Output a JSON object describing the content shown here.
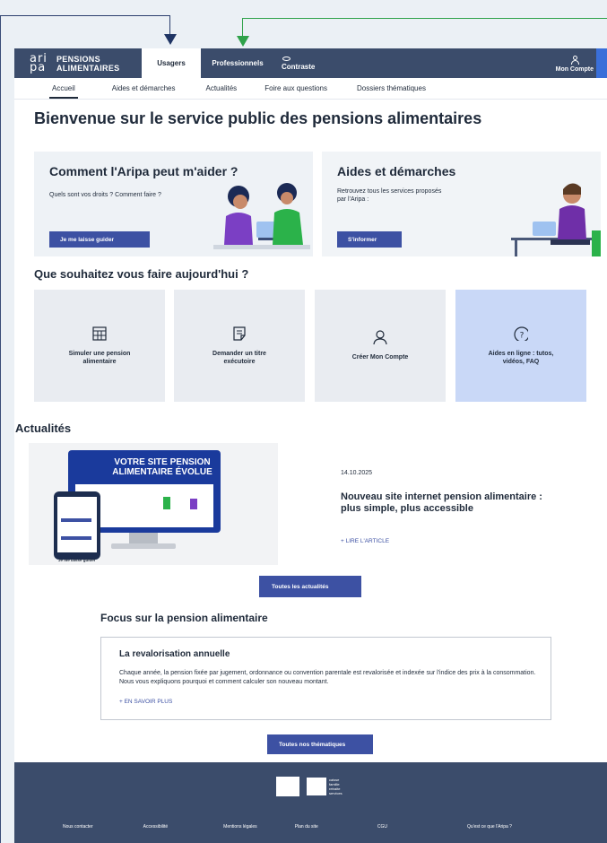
{
  "header": {
    "logo_mark": "ari pa",
    "logo_line1": "PENSIONS",
    "logo_line2": "ALIMENTAIRES",
    "tab_usagers": "Usagers",
    "tab_pros": "Professionnels",
    "contraste": "Contraste",
    "mon_compte": "Mon Compte"
  },
  "subnav": [
    "Accueil",
    "Aides et démarches",
    "Actualités",
    "Foire aux questions",
    "Dossiers thématiques"
  ],
  "welcome": "Bienvenue sur le service public des pensions alimentaires",
  "card1": {
    "title": "Comment l'Aripa peut m'aider ?",
    "text": "Quels sont vos droits ? Comment faire ?",
    "button": "Je me laisse guider"
  },
  "card2": {
    "title": "Aides et démarches",
    "text1": "Retrouvez tous les services proposés",
    "text2": "par l'Aripa :",
    "button": "S'informer"
  },
  "question": "Que souhaitez vous faire aujourd'hui ?",
  "tiles": [
    {
      "label1": "Simuler une pension",
      "label2": "alimentaire",
      "icon": "calculator-icon"
    },
    {
      "label1": "Demander un titre",
      "label2": "exécutoire",
      "icon": "document-icon"
    },
    {
      "label1": "Créer Mon Compte",
      "label2": "",
      "icon": "user-icon"
    },
    {
      "label1": "Aides en ligne : tutos,",
      "label2": "vidéos, FAQ",
      "icon": "help-icon"
    }
  ],
  "actualites": {
    "title": "Actualités",
    "img_line1": "VOTRE SITE PENSION",
    "img_line2": "ALIMENTAIRE ÉVOLUE",
    "img_phone_title": "Je me laisse guider",
    "date": "14.10.2025",
    "headline": "Nouveau site internet pension alimentaire : plus simple, plus accessible",
    "link": "+ LIRE L'ARTICLE",
    "all_button": "Toutes les actualités"
  },
  "focus": {
    "title": "Focus sur la pension alimentaire",
    "box_title": "La revalorisation annuelle",
    "box_text": "Chaque année, la pension fixée par jugement, ordonnance ou convention parentale est revalorisée et indexée sur l'indice des prix à la consommation. Nous vous expliquons pourquoi et comment calculer son nouveau montant.",
    "link": "+ EN SAVOIR PLUS",
    "all_button": "Toutes nos thématiques"
  },
  "footer": {
    "logo2_text": [
      "caisse",
      "famille",
      "retraite",
      "services"
    ],
    "links": [
      "Nous contacter",
      "Accessibilité",
      "Mentions légales",
      "Plan du site",
      "CGU",
      "Qu'est ce que l'Aripa ?"
    ]
  },
  "colors": {
    "nav": "#3b4c6b",
    "button": "#3d51a3",
    "highlight_tile": "#c9d8f7",
    "arrow_green": "#2fa24a",
    "arrow_blue": "#1f3464"
  }
}
